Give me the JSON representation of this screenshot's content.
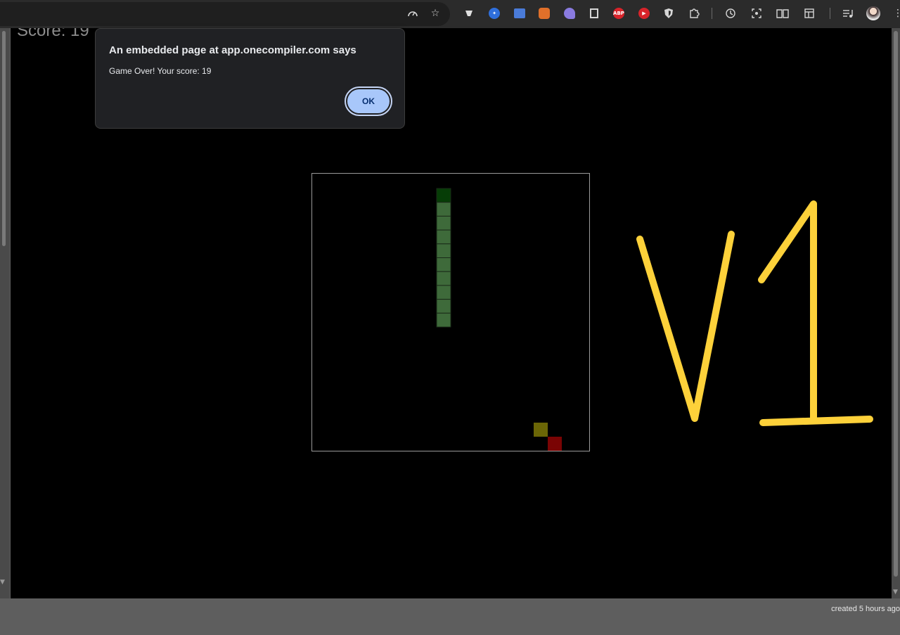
{
  "page": {
    "score_label": "Score: 19"
  },
  "game": {
    "colors": {
      "snake_head": "#063d06",
      "snake_body": "#3e6a3a",
      "snake_outline": "#1a2a18",
      "food": "#6b6606",
      "crash": "#7a0404",
      "board_border": "#9a9a9a"
    },
    "annotation": "V1",
    "annotation_color": "#fdd13a"
  },
  "dialog": {
    "title": "An embedded page at app.onecompiler.com says",
    "message": "Game Over! Your score: 19",
    "ok_label": "OK"
  },
  "footer": {
    "created": "created 5 hours ago"
  },
  "toolbar": {
    "icons": [
      "performance-icon",
      "bookmark-star-icon",
      "extension-1-icon",
      "extension-2-icon",
      "extension-3-icon",
      "extension-4-icon",
      "extension-5-icon",
      "extension-6-icon",
      "adblock-plus-icon",
      "extension-8-icon",
      "extension-9-icon",
      "extensions-puzzle-icon",
      "history-icon",
      "screenshot-icon",
      "reading-mode-icon",
      "side-panel-icon",
      "media-controls-icon",
      "profile-avatar"
    ],
    "adblock_label": "ABP"
  }
}
